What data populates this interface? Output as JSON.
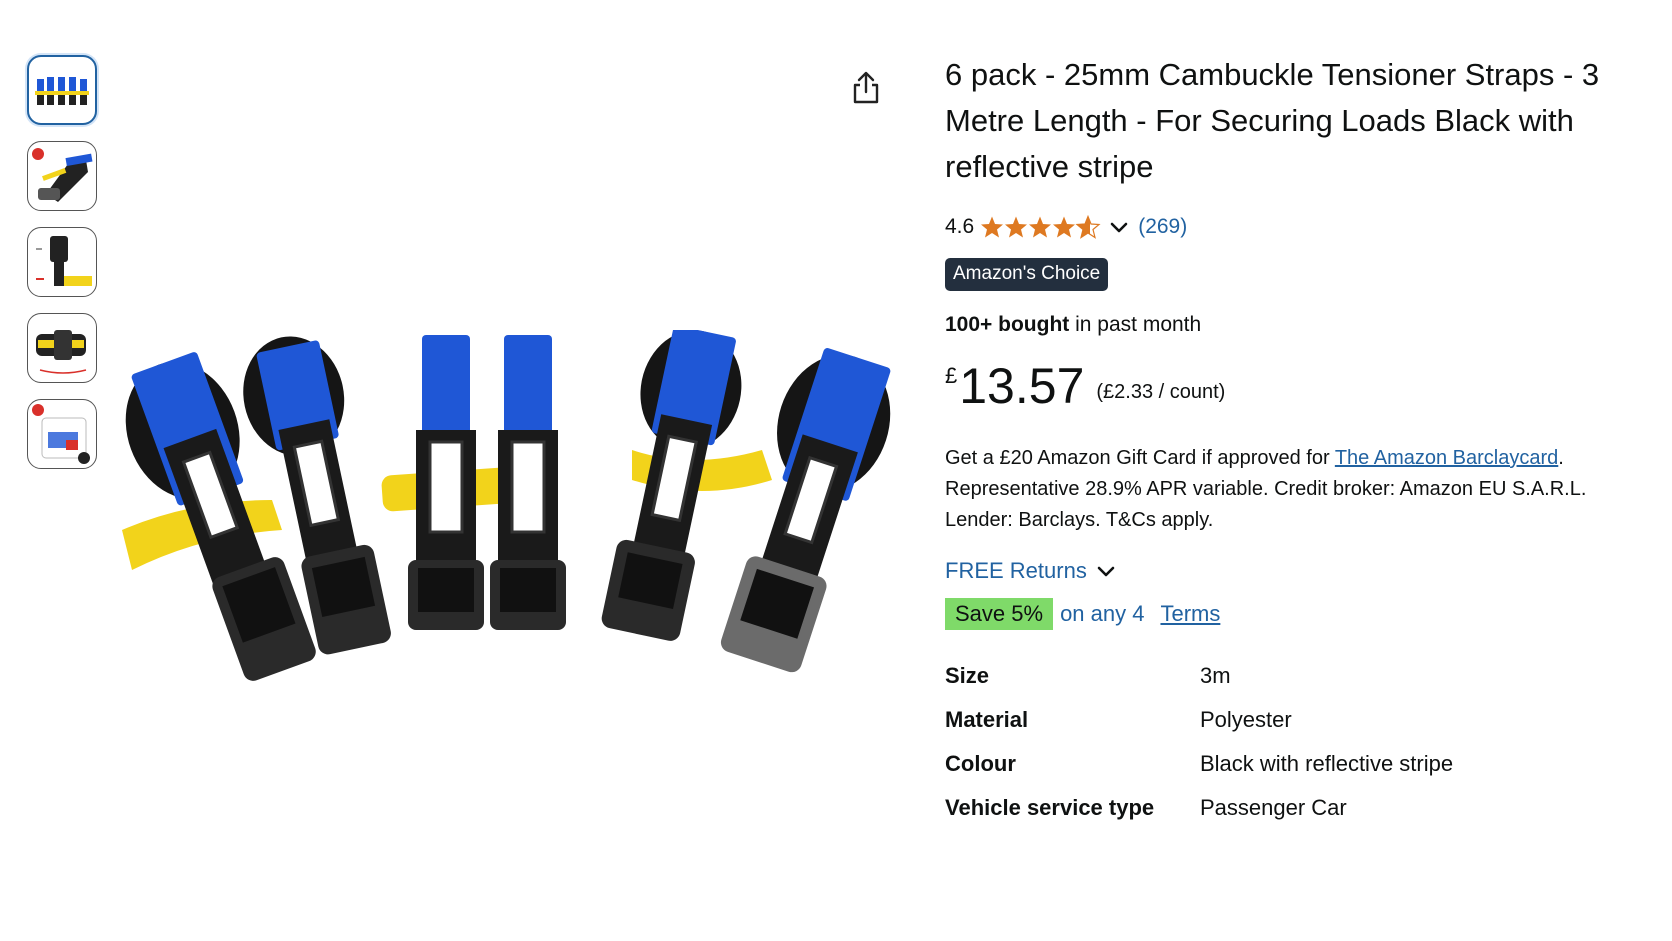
{
  "product": {
    "title": "6 pack - 25mm Cambuckle Tensioner Straps - 3 Metre Length - For Securing Loads Black with reflective stripe",
    "rating": "4.6",
    "rating_value": 4.6,
    "review_count": "(269)",
    "badge": "Amazon's Choice",
    "bought_bold": "100+ bought",
    "bought_rest": " in past month",
    "currency": "£",
    "price": "13.57",
    "unit_price": "(£2.33 / count)"
  },
  "promo": {
    "line1_prefix": "Get a £20 Amazon Gift Card if approved for ",
    "link": "The Amazon Barclaycard",
    "line1_suffix": ".",
    "line2": "Representative 28.9% APR variable. Credit broker: Amazon EU S.A.R.L.",
    "line3": "Lender: Barclays. T&Cs apply."
  },
  "returns": {
    "label": "FREE Returns"
  },
  "savings": {
    "badge": "Save 5%",
    "text": "on any 4",
    "terms": "Terms"
  },
  "specs": [
    {
      "key": "Size",
      "value": "3m"
    },
    {
      "key": "Material",
      "value": "Polyester"
    },
    {
      "key": "Colour",
      "value": "Black with reflective stripe"
    },
    {
      "key": "Vehicle service type",
      "value": "Passenger Car"
    }
  ],
  "icons": {
    "share": "share-icon",
    "chevron": "chevron-down-icon",
    "star": "star-icon"
  },
  "colors": {
    "link": "#2162a1",
    "star": "#de7921",
    "badge_bg": "#232f3e",
    "save_bg": "#7fda69",
    "strap_blue": "#1f57d6",
    "strap_yellow": "#f2d31b"
  }
}
